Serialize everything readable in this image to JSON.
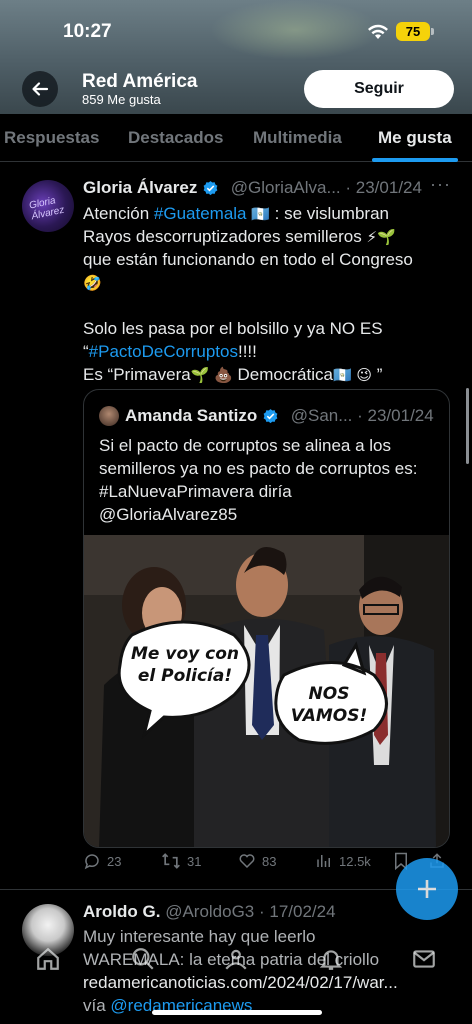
{
  "status_bar": {
    "time": "10:27",
    "battery": "75"
  },
  "profile": {
    "name": "Red América",
    "likes": "859 Me gusta",
    "follow_label": "Seguir"
  },
  "tabs": [
    {
      "label": "Respuestas",
      "active": false
    },
    {
      "label": "Destacados",
      "active": false
    },
    {
      "label": "Multimedia",
      "active": false
    },
    {
      "label": "Me gusta",
      "active": true
    }
  ],
  "tweet1": {
    "author": "Gloria Álvarez",
    "handle": "@GloriaAlva...",
    "date": "· 23/01/24",
    "avatar_text": "Gloria Álvarez",
    "lines": {
      "l1_pre": "Atención ",
      "l1_link": "#Guatemala",
      "l1_post": " : se vislumbran",
      "l2": "Rayos descorruptizadores semilleros",
      "l3": "que están funcionando en todo el Congreso",
      "l5": "Solo les pasa por el bolsillo y ya NO ES",
      "l6_pre": "“",
      "l6_link": "#PactoDeCorruptos",
      "l6_post": "!!!!",
      "l7_pre": "Es “Primavera",
      "l7_mid": " Democrática",
      "l7_post": " ”"
    },
    "quote": {
      "author": "Amanda Santizo",
      "handle": "@San...",
      "date": "· 23/01/24",
      "lines": [
        "Si el pacto de corruptos se alinea a los",
        "semilleros ya no es pacto de corruptos es:",
        "#LaNuevaPrimavera diría",
        "@GloriaAlvarez85"
      ],
      "bubble_left": "Me voy con el Policía!",
      "bubble_right": "NOS VAMOS!"
    },
    "actions": {
      "replies": "23",
      "retweets": "31",
      "likes": "83",
      "views": "12.5k"
    }
  },
  "tweet2": {
    "author": "Aroldo G.",
    "handle": "@AroldoG3",
    "date": "· 17/02/24",
    "lines": [
      "Muy interesante hay que leerlo",
      "WAREMALA: la eterna patria del criollo"
    ],
    "link": "redamericanoticias.com/2024/02/17/war...",
    "via_pre": "vía ",
    "via_link": "@redamericanews"
  },
  "colors": {
    "accent": "#1d9bf0",
    "background": "#000000",
    "text": "#e7e9ea",
    "muted": "#71767b"
  }
}
